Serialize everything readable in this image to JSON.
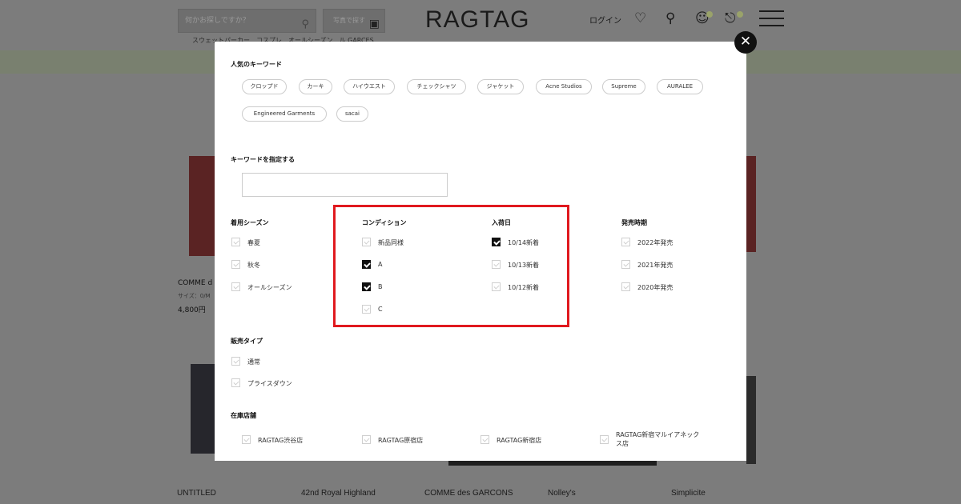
{
  "header": {
    "search_placeholder": "何かお探しですか？",
    "photo_search_label": "写真で探す",
    "logo": "RAGTAG",
    "login_label": "ログイン",
    "cart_badge": ""
  },
  "trend_text": "スウェットパーカー　コスプレ　オールシーズン　ル GARCES",
  "background_products": {
    "top": {
      "brand": "COMME d",
      "size": "サイズ：0/M",
      "price": "4,800円"
    },
    "brands": [
      "UNTITLED",
      "42nd Royal Highland",
      "COMME des GARCONS",
      "Nolley's",
      "Simplicite"
    ]
  },
  "modal": {
    "popular_keywords_title": "人気のキーワード",
    "keywords": [
      "クロップド",
      "カーキ",
      "ハイウエスト",
      "チェックシャツ",
      "ジャケット",
      "Acne Studios",
      "Supreme",
      "AURALEE",
      "Engineered Garments",
      "sacai"
    ],
    "keyword_input_title": "キーワードを指定する",
    "keyword_input_value": "",
    "season": {
      "title": "着用シーズン",
      "options": [
        {
          "label": "春夏",
          "checked": false
        },
        {
          "label": "秋冬",
          "checked": false
        },
        {
          "label": "オールシーズン",
          "checked": false
        }
      ]
    },
    "condition": {
      "title": "コンディション",
      "options": [
        {
          "label": "新品同様",
          "checked": false
        },
        {
          "label": "A",
          "checked": true
        },
        {
          "label": "B",
          "checked": true
        },
        {
          "label": "C",
          "checked": false
        }
      ]
    },
    "arrival": {
      "title": "入荷日",
      "options": [
        {
          "label": "10/14新着",
          "checked": true
        },
        {
          "label": "10/13新着",
          "checked": false
        },
        {
          "label": "10/12新着",
          "checked": false
        }
      ]
    },
    "release": {
      "title": "発売時期",
      "options": [
        {
          "label": "2022年発売",
          "checked": false
        },
        {
          "label": "2021年発売",
          "checked": false
        },
        {
          "label": "2020年発売",
          "checked": false
        }
      ]
    },
    "sale_type": {
      "title": "販売タイプ",
      "options": [
        {
          "label": "通常",
          "checked": false
        },
        {
          "label": "プライスダウン",
          "checked": false
        }
      ]
    },
    "stores": {
      "title": "在庫店舗",
      "options": [
        {
          "label": "RAGTAG渋谷店",
          "checked": false
        },
        {
          "label": "RAGTAG原宿店",
          "checked": false
        },
        {
          "label": "RAGTAG新宿店",
          "checked": false
        },
        {
          "label": "RAGTAG新宿マルイアネックス店",
          "checked": false
        }
      ]
    },
    "close_icon": "close-icon"
  },
  "colors": {
    "highlight": "#e0191e",
    "overlay": "#7c7c7c",
    "checked": "#111111"
  }
}
